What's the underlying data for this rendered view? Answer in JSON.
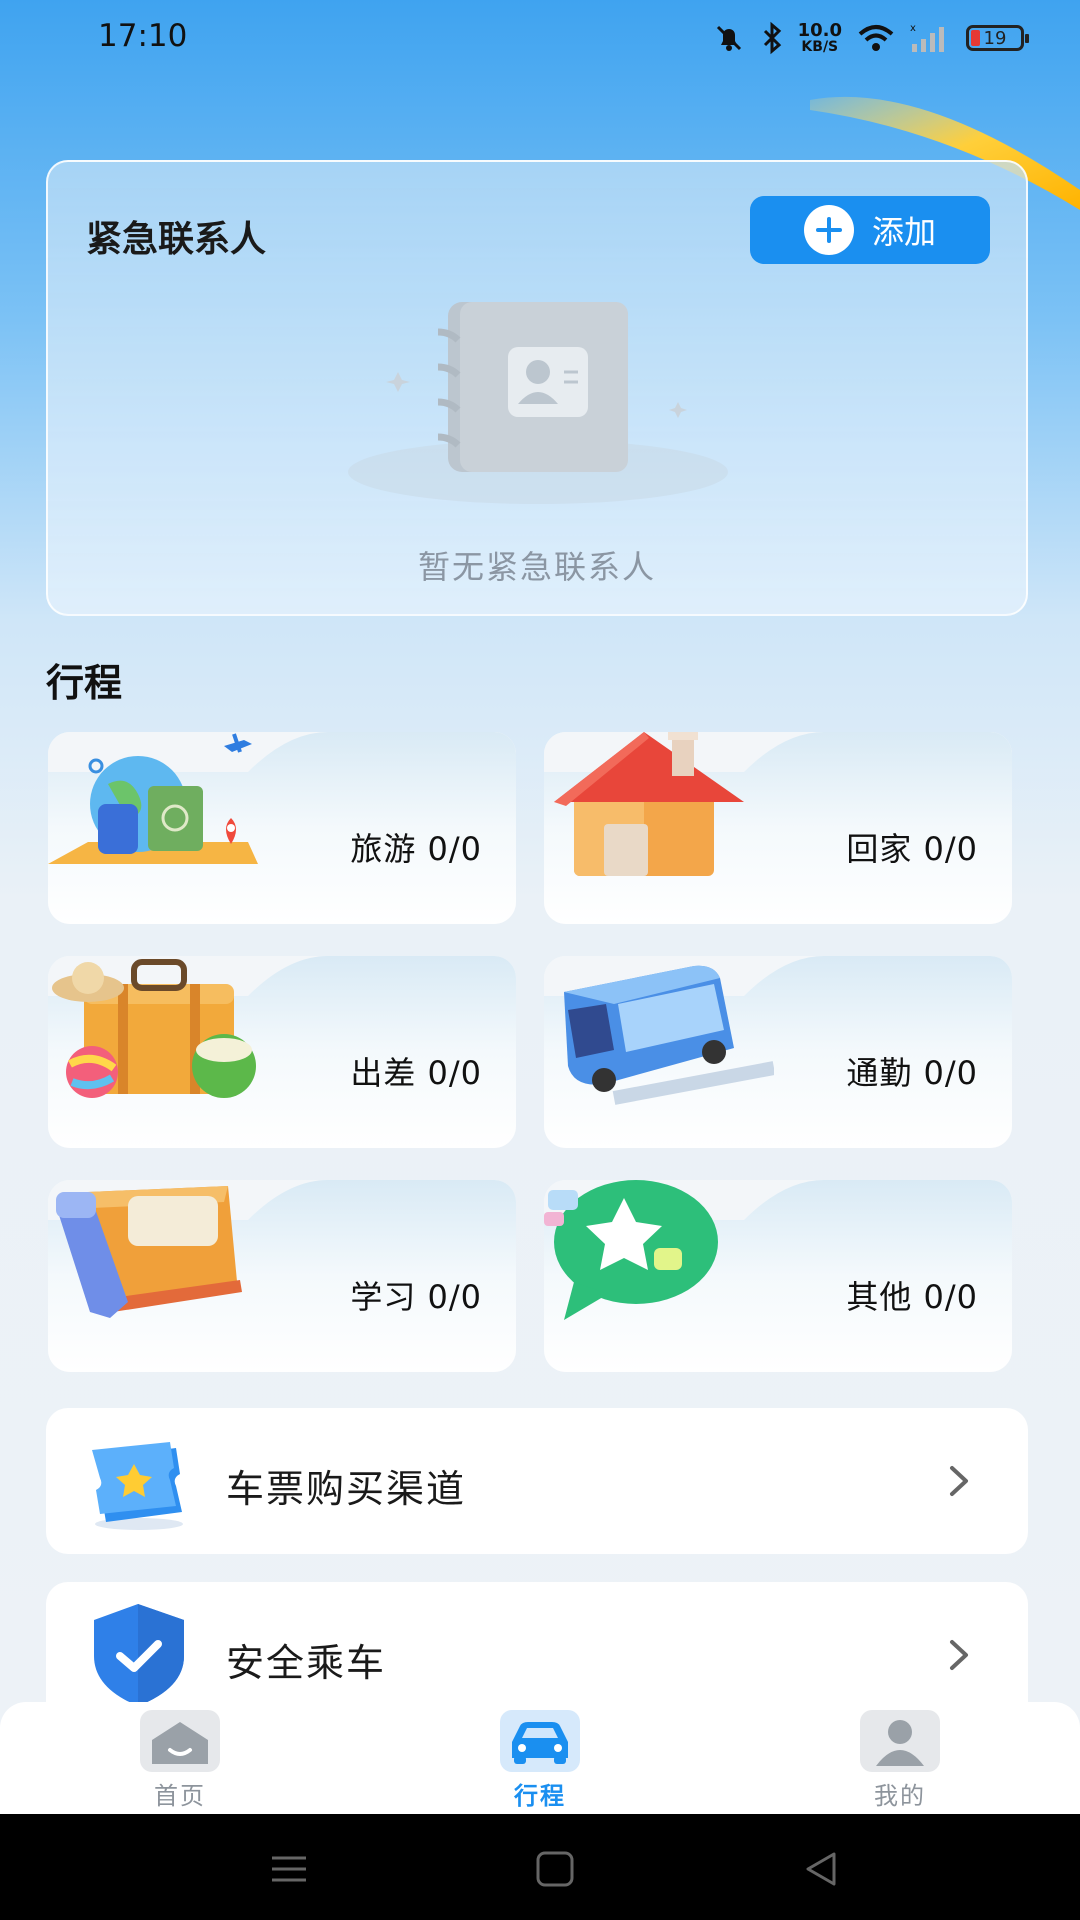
{
  "status_bar": {
    "time": "17:10",
    "net_speed_value": "10.0",
    "net_speed_unit": "KB/S",
    "battery_level": "19",
    "icons": [
      "mute-bell-icon",
      "bluetooth-icon",
      "wifi-icon",
      "cellular-signal-icon",
      "battery-icon"
    ]
  },
  "emergency_contacts": {
    "title": "紧急联系人",
    "add_label": "添加",
    "empty_text": "暂无紧急联系人"
  },
  "trips": {
    "section_title": "行程",
    "items": [
      {
        "name": "旅游",
        "count": "0/0",
        "label": "旅游  0/0",
        "icon": "travel-globe-icon"
      },
      {
        "name": "回家",
        "count": "0/0",
        "label": "回家  0/0",
        "icon": "house-icon"
      },
      {
        "name": "出差",
        "count": "0/0",
        "label": "出差  0/0",
        "icon": "suitcase-icon"
      },
      {
        "name": "通勤",
        "count": "0/0",
        "label": "通勤  0/0",
        "icon": "bus-icon"
      },
      {
        "name": "学习",
        "count": "0/0",
        "label": "学习 0/0",
        "icon": "notebook-icon"
      },
      {
        "name": "其他",
        "count": "0/0",
        "label": "其他 0/0",
        "icon": "star-bubble-icon"
      }
    ]
  },
  "links": [
    {
      "label": "车票购买渠道",
      "icon": "ticket-icon"
    },
    {
      "label": "安全乘车",
      "icon": "shield-check-icon"
    }
  ],
  "tab_bar": {
    "tabs": [
      {
        "label": "首页",
        "icon": "home-icon",
        "active": false
      },
      {
        "label": "行程",
        "icon": "car-icon",
        "active": true
      },
      {
        "label": "我的",
        "icon": "person-icon",
        "active": false
      }
    ]
  },
  "colors": {
    "accent": "#1a8ff0",
    "inactive_tab": "#8d949c"
  }
}
